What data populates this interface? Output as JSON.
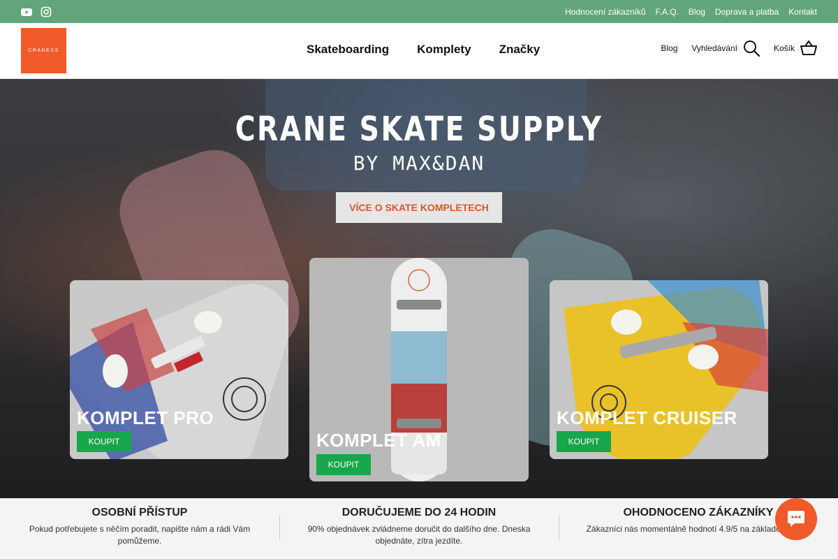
{
  "topbar": {
    "social_icons": [
      "youtube-icon",
      "instagram-icon"
    ],
    "links": [
      "Hodnocení zákazníků",
      "F.A.Q.",
      "Blog",
      "Doprava a platba",
      "Kontakt"
    ]
  },
  "header": {
    "logo_text": "CRANESS",
    "nav": [
      "Skateboarding",
      "Komplety",
      "Značky"
    ],
    "blog_label": "Blog",
    "search_label": "Vyhledávání",
    "cart_label": "Košík"
  },
  "hero": {
    "title": "CRANE SKATE SUPPLY",
    "subtitle": "BY MAX&DAN",
    "cta_label": "VÍCE O SKATE KOMPLETECH"
  },
  "products": [
    {
      "name": "KOMPLET PRO",
      "button": "KOUPIT"
    },
    {
      "name": "KOMPLET AM",
      "button": "KOUPIT"
    },
    {
      "name": "KOMPLET CRUISER",
      "button": "KOUPIT"
    }
  ],
  "features": [
    {
      "title": "OSOBNÍ PŘÍSTUP",
      "text": "Pokud potřebujete s něčím poradit, napište nám a rádi Vám pomůžeme."
    },
    {
      "title": "DORUČUJEME DO 24 HODIN",
      "text": "90% objednávek zvládneme doručit do dalšího dne. Dneska objednáte, zítra jezdíte."
    },
    {
      "title": "OHODNOCENO ZÁKAZNÍKY",
      "text": "Zákazníci nás momentálně hodnotí 4.9/5 na základě recenzí"
    }
  ],
  "colors": {
    "topbar": "#62a57a",
    "brand": "#f15a2b",
    "buy_button": "#18a64a"
  }
}
